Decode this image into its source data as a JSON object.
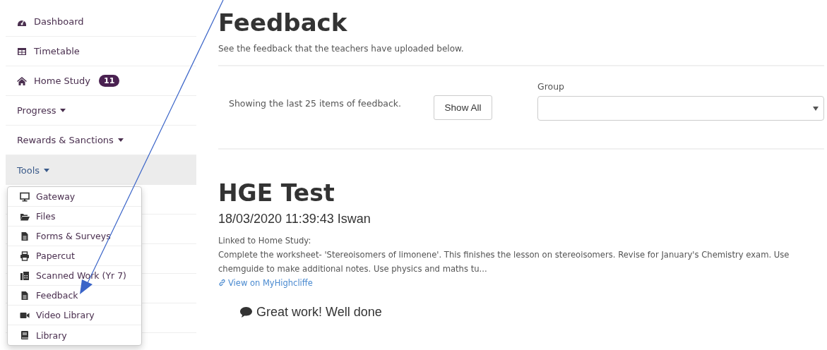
{
  "sidebar": {
    "items": [
      {
        "kind": "link",
        "label": "Dashboard"
      },
      {
        "kind": "link",
        "label": "Timetable"
      },
      {
        "kind": "link",
        "label": "Home Study",
        "badge": "11"
      },
      {
        "kind": "dropdown",
        "label": "Progress",
        "expanded": false
      },
      {
        "kind": "dropdown",
        "label": "Rewards & Sanctions",
        "expanded": false
      },
      {
        "kind": "dropdown",
        "label": "Tools",
        "expanded": true,
        "menu": [
          {
            "label": "Gateway"
          },
          {
            "label": "Files"
          },
          {
            "label": "Forms & Surveys"
          },
          {
            "label": "Papercut"
          },
          {
            "label": "Scanned Work (Yr 7)"
          },
          {
            "label": "Feedback"
          },
          {
            "label": "Video Library"
          },
          {
            "label": "Library"
          }
        ]
      }
    ]
  },
  "page": {
    "title": "Feedback",
    "subtitle": "See the feedback that the teachers have uploaded below.",
    "filter": {
      "info": "Showing the last 25 items of feedback.",
      "button": "Show All",
      "group": {
        "label": "Group"
      }
    }
  },
  "feedback": [
    {
      "title": "HGE Test",
      "meta": "18/03/2020 11:39:43 Iswan",
      "linked_label": "Linked to Home Study:",
      "description": "Complete the worksheet- 'Stereoisomers of limonene'. This finishes the lesson on stereoisomers. Revise for January's Chemistry exam. Use chemguide to make additional notes. Use physics and maths tu...",
      "link": "View on MyHighcliffe",
      "comment": "Great work! Well done"
    }
  ],
  "annotation": {
    "kind": "arrow"
  }
}
